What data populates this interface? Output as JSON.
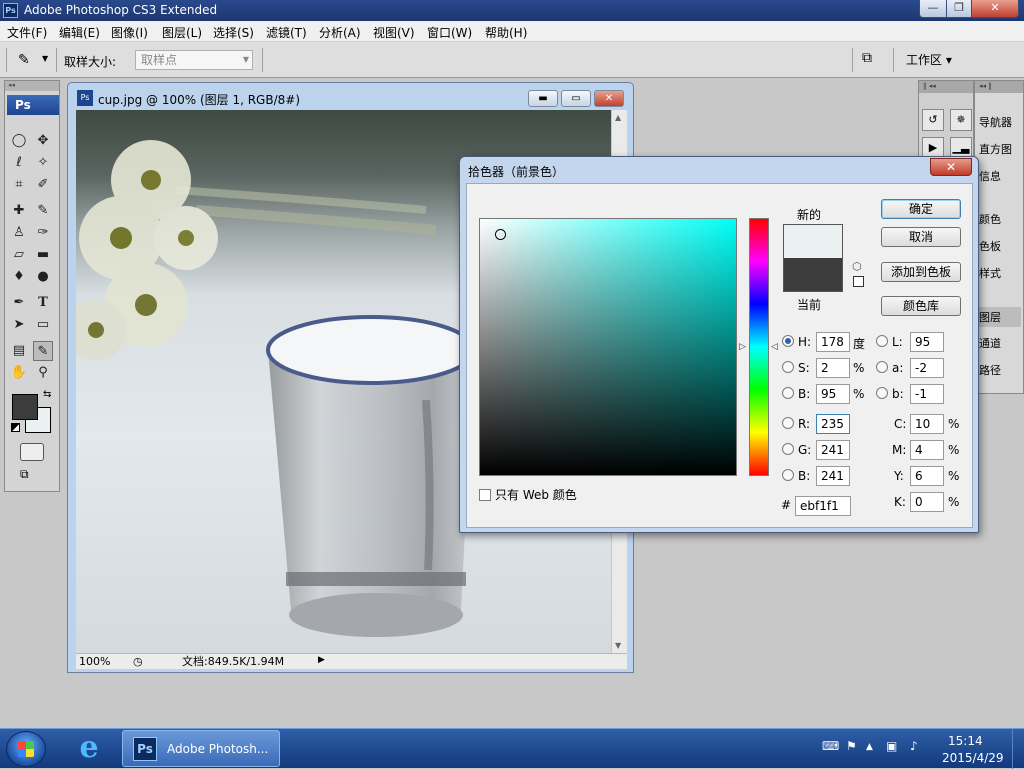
{
  "app": {
    "title": "Adobe Photoshop CS3 Extended",
    "logo_text": "Ps"
  },
  "window_controls": {
    "minimize": "—",
    "maximize": "❐",
    "close": "✕"
  },
  "menubar": {
    "items": [
      "文件(F)",
      "编辑(E)",
      "图像(I)",
      "图层(L)",
      "选择(S)",
      "滤镜(T)",
      "分析(A)",
      "视图(V)",
      "窗口(W)",
      "帮助(H)"
    ]
  },
  "options_bar": {
    "sample_size_label": "取样大小:",
    "sample_size_value": "取样点",
    "workspace_label": "工作区 ▾"
  },
  "toolbox": {
    "badge": "Ps",
    "active_tool": "eyedropper-tool"
  },
  "document": {
    "title": "cup.jpg @ 100% (图层 1, RGB/8#)",
    "zoom": "100%",
    "info": "文档:849.5K/1.94M"
  },
  "panels": {
    "group1": [
      "导航器",
      "直方图",
      "信息"
    ],
    "group2": [
      "颜色",
      "色板",
      "样式"
    ],
    "group3": [
      "图层",
      "通道",
      "路径"
    ],
    "selected": "图层"
  },
  "color_picker": {
    "title": "拾色器（前景色）",
    "new_label": "新的",
    "current_label": "当前",
    "new_color": "#ebf1f1",
    "current_color": "#3c3c3c",
    "buttons": {
      "ok": "确定",
      "cancel": "取消",
      "add_to_swatches": "添加到色板",
      "color_libraries": "颜色库"
    },
    "hsb": {
      "h": {
        "label": "H:",
        "value": "178",
        "unit": "度"
      },
      "s": {
        "label": "S:",
        "value": "2",
        "unit": "%"
      },
      "b": {
        "label": "B:",
        "value": "95",
        "unit": "%"
      }
    },
    "rgb": {
      "r": {
        "label": "R:",
        "value": "235"
      },
      "g": {
        "label": "G:",
        "value": "241"
      },
      "b": {
        "label": "B:",
        "value": "241"
      }
    },
    "lab": {
      "l": {
        "label": "L:",
        "value": "95"
      },
      "a": {
        "label": "a:",
        "value": "-2"
      },
      "b": {
        "label": "b:",
        "value": "-1"
      }
    },
    "cmyk": {
      "c": {
        "label": "C:",
        "value": "10",
        "unit": "%"
      },
      "m": {
        "label": "M:",
        "value": "4",
        "unit": "%"
      },
      "y": {
        "label": "Y:",
        "value": "6",
        "unit": "%"
      },
      "k": {
        "label": "K:",
        "value": "0",
        "unit": "%"
      }
    },
    "hex_label": "#",
    "hex_value": "ebf1f1",
    "web_only_label": "只有 Web 颜色",
    "selected_mode": "H"
  },
  "taskbar": {
    "ps_task_label": "Adobe Photosh...",
    "ps_task_icon": "Ps",
    "ie_icon": "e",
    "time": "15:14",
    "date": "2015/4/29"
  }
}
